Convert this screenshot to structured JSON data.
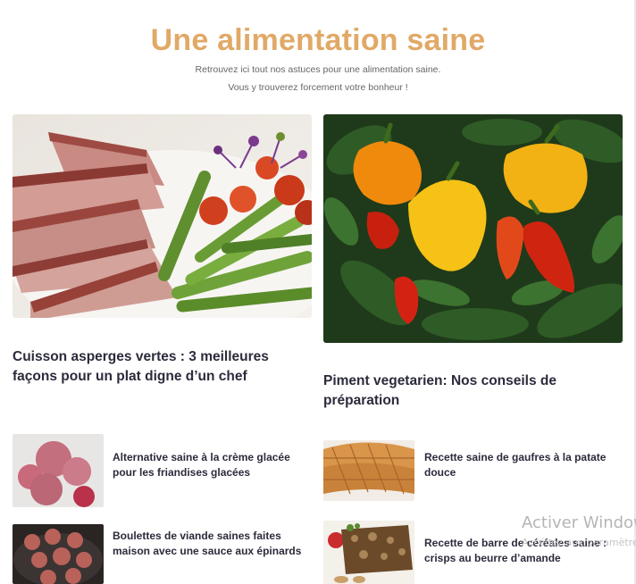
{
  "page": {
    "title": "Une alimentation saine",
    "intro_line1": "Retrouvez ici tout nos astuces pour une alimentation saine.",
    "intro_line2": "Vous y trouverez forcement votre bonheur !"
  },
  "featured": [
    {
      "title": "Cuisson asperges vertes : 3 meilleures façons pour un plat digne d’un chef",
      "image": "steak-asparagus-photo"
    },
    {
      "title": "Piment vegetarien: Nos conseils de préparation",
      "image": "peppers-photo"
    }
  ],
  "articles": [
    {
      "title": "Alternative saine à la crème glacée pour les friandises glacées",
      "image": "frozen-berries-photo"
    },
    {
      "title": "Recette saine de gaufres à la patate douce",
      "image": "waffles-photo"
    },
    {
      "title": "Boulettes de viande saines faites maison avec une sauce aux épinards",
      "image": "meatballs-photo"
    },
    {
      "title": "Recette de barre de céréales saine : crisps au beurre d’amande",
      "image": "cereal-bar-photo"
    }
  ],
  "overlay": {
    "watermark": "Activer Windows",
    "watermark_sub": "Accédez aux paramètres"
  }
}
